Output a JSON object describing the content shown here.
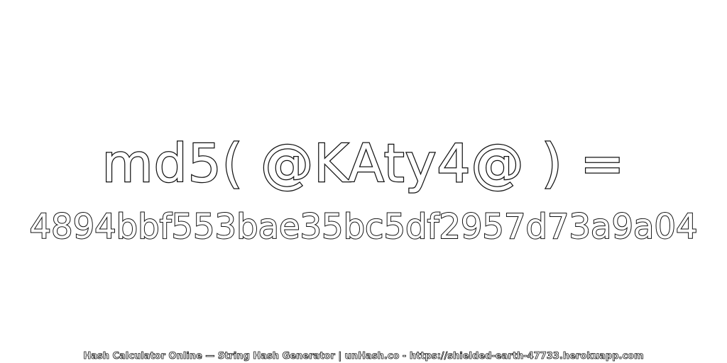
{
  "headline": "md5( @KAty4@ ) =",
  "hash_value": "4894bbf553bae35bc5df2957d73a9a04",
  "footer": "Hash Calculator Online — String Hash Generator | unHash.co - https://shielded-earth-47733.herokuapp.com",
  "colors": {
    "background": "#ffffff",
    "outline": "#111111",
    "fill": "#ffffff"
  }
}
